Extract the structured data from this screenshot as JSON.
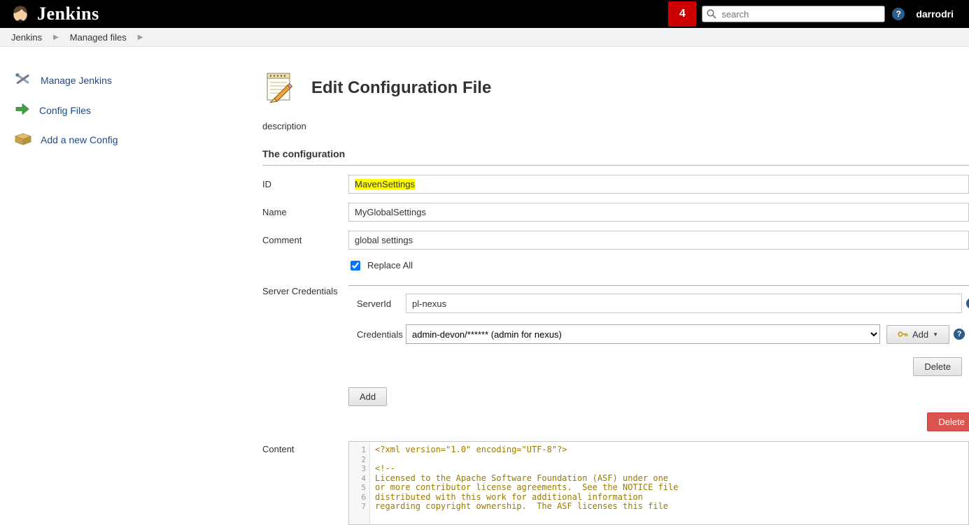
{
  "colors": {
    "header-bg": "#000000",
    "badge-red": "#cc0000",
    "link-blue": "#204a87",
    "highlight-yellow": "#ffff00",
    "danger-red": "#d9534f",
    "code-text": "#9a7b00"
  },
  "header": {
    "brand": "Jenkins",
    "badge_count": "4",
    "search_placeholder": "search",
    "help_label": "?",
    "username": "darrodri"
  },
  "breadcrumb": {
    "items": [
      {
        "label": "Jenkins"
      },
      {
        "label": "Managed files"
      }
    ]
  },
  "sidebar": {
    "items": [
      {
        "label": "Manage Jenkins"
      },
      {
        "label": "Config Files"
      },
      {
        "label": "Add a new Config"
      }
    ]
  },
  "main": {
    "title": "Edit Configuration File",
    "description_label": "description",
    "section_title": "The configuration",
    "form": {
      "id": {
        "label": "ID",
        "value": "MavenSettings"
      },
      "name": {
        "label": "Name",
        "value": "MyGlobalSettings"
      },
      "comment": {
        "label": "Comment",
        "value": "global settings"
      },
      "replace_all": {
        "label": "Replace All",
        "checked": "checked"
      },
      "server_credentials": {
        "label": "Server Credentials",
        "server_id": {
          "label": "ServerId",
          "value": "pl-nexus"
        },
        "credentials": {
          "label": "Credentials",
          "selected": "admin-devon/****** (admin for nexus)"
        },
        "add_button": "Add",
        "delete_button": "Delete",
        "help_label": "?"
      },
      "add_button": "Add",
      "delete_button": "Delete",
      "content_label": "Content"
    },
    "editor": {
      "lines": [
        {
          "num": "1",
          "code": "<?xml version=\"1.0\" encoding=\"UTF-8\"?>"
        },
        {
          "num": "2",
          "code": ""
        },
        {
          "num": "3",
          "code": "<!--"
        },
        {
          "num": "4",
          "code": "Licensed to the Apache Software Foundation (ASF) under one"
        },
        {
          "num": "5",
          "code": "or more contributor license agreements.  See the NOTICE file"
        },
        {
          "num": "6",
          "code": "distributed with this work for additional information"
        },
        {
          "num": "7",
          "code": "regarding copyright ownership.  The ASF licenses this file"
        }
      ]
    }
  }
}
